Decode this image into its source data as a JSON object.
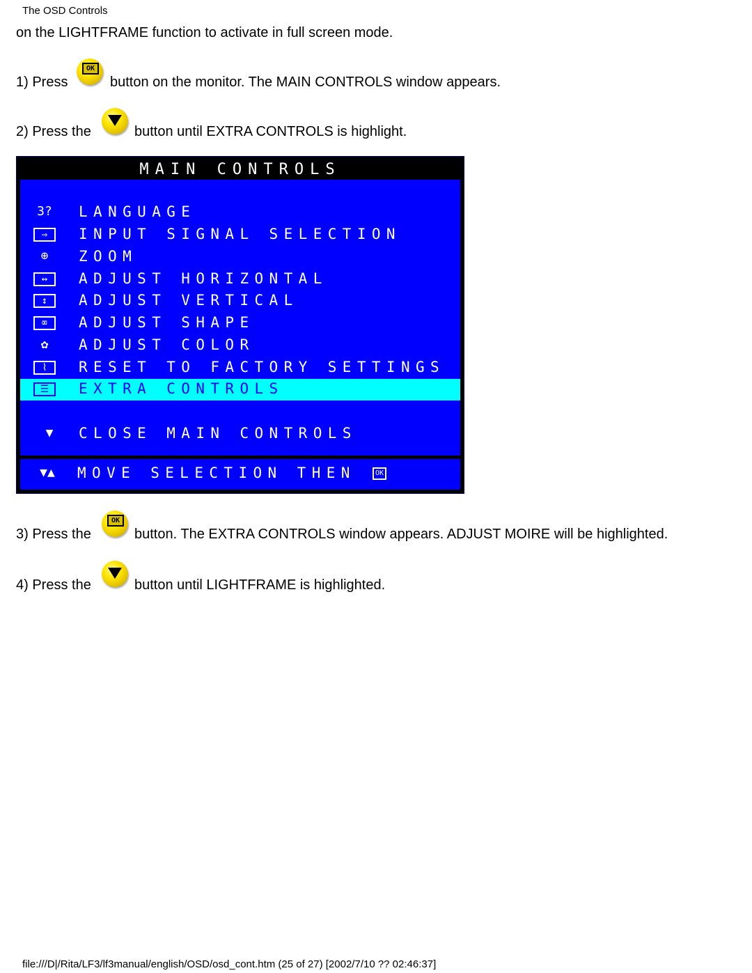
{
  "header": {
    "title": "The OSD Controls"
  },
  "content": {
    "intro": "on the LIGHTFRAME function to activate in full screen mode.",
    "steps": [
      {
        "prefix": "1) Press",
        "icon": "ok-button-icon",
        "text": "button on the monitor. The MAIN CONTROLS window appears."
      },
      {
        "prefix": "2) Press the",
        "icon": "down-button-icon",
        "text": "button until EXTRA CONTROLS is highlight."
      },
      {
        "prefix": "3) Press the",
        "icon": "ok-button-icon",
        "text": "button. The EXTRA CONTROLS window appears. ADJUST MOIRE will be highlighted."
      },
      {
        "prefix": "4) Press the",
        "icon": "down-button-icon",
        "text": "button until LIGHTFRAME is highlighted."
      }
    ],
    "ok_glyph": "OK"
  },
  "osd": {
    "title": "MAIN CONTROLS",
    "items": [
      {
        "label": "LANGUAGE",
        "icon": "language-icon",
        "glyph": "3?"
      },
      {
        "label": "INPUT SIGNAL SELECTION",
        "icon": "input-signal-icon",
        "glyph": "⇒"
      },
      {
        "label": "ZOOM",
        "icon": "zoom-icon",
        "glyph": "⊕"
      },
      {
        "label": "ADJUST HORIZONTAL",
        "icon": "horizontal-icon",
        "glyph": "↔"
      },
      {
        "label": "ADJUST VERTICAL",
        "icon": "vertical-icon",
        "glyph": "↕"
      },
      {
        "label": "ADJUST SHAPE",
        "icon": "shape-icon",
        "glyph": "⌧"
      },
      {
        "label": "ADJUST COLOR",
        "icon": "color-palette-icon",
        "glyph": "✿"
      },
      {
        "label": "RESET TO FACTORY SETTINGS",
        "icon": "factory-icon",
        "glyph": "⌇"
      },
      {
        "label": "EXTRA CONTROLS",
        "icon": "extra-controls-icon",
        "glyph": "☰",
        "selected": true
      }
    ],
    "close": {
      "label": "CLOSE MAIN CONTROLS",
      "glyph": "▼"
    },
    "hint": {
      "label": "MOVE SELECTION THEN",
      "glyph": "▼▲",
      "ok": "OK"
    },
    "colors": {
      "background": "#0000ff",
      "highlight": "#00ffff",
      "frame": "#000000",
      "text": "#ffffff"
    }
  },
  "footer": {
    "text": "file:///D|/Rita/LF3/lf3manual/english/OSD/osd_cont.htm (25 of 27) [2002/7/10 ?? 02:46:37]"
  }
}
